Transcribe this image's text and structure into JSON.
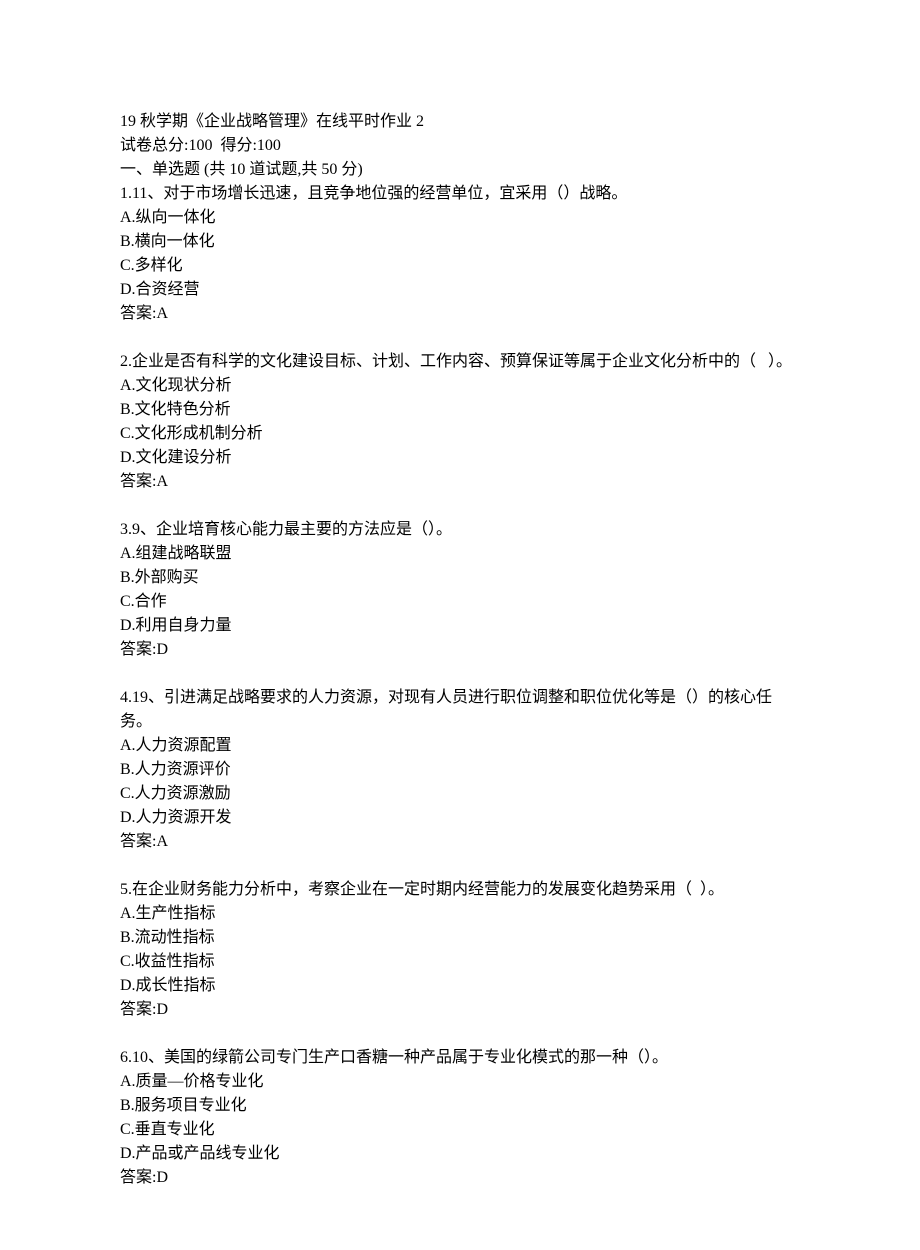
{
  "header": {
    "title": "19 秋学期《企业战略管理》在线平时作业 2",
    "score_line": "试卷总分:100  得分:100",
    "section_line": "一、单选题 (共 10 道试题,共 50 分)"
  },
  "questions": [
    {
      "stem": "1.11、对于市场增长迅速，且竞争地位强的经营单位，宜采用（）战略。",
      "options": [
        "A.纵向一体化",
        "B.横向一体化",
        "C.多样化",
        "D.合资经营"
      ],
      "answer": "答案:A"
    },
    {
      "stem": "2.企业是否有科学的文化建设目标、计划、工作内容、预算保证等属于企业文化分析中的（   ）。",
      "options": [
        "A.文化现状分析",
        "B.文化特色分析",
        "C.文化形成机制分析",
        "D.文化建设分析"
      ],
      "answer": "答案:A"
    },
    {
      "stem": "3.9、企业培育核心能力最主要的方法应是（）。",
      "options": [
        "A.组建战略联盟",
        "B.外部购买",
        "C.合作",
        "D.利用自身力量"
      ],
      "answer": "答案:D"
    },
    {
      "stem": "4.19、引进满足战略要求的人力资源，对现有人员进行职位调整和职位优化等是（）的核心任务。",
      "options": [
        "A.人力资源配置",
        "B.人力资源评价",
        "C.人力资源激励",
        "D.人力资源开发"
      ],
      "answer": "答案:A"
    },
    {
      "stem": "5.在企业财务能力分析中，考察企业在一定时期内经营能力的发展变化趋势采用（  ）。",
      "options": [
        "A.生产性指标",
        "B.流动性指标",
        "C.收益性指标",
        "D.成长性指标"
      ],
      "answer": "答案:D"
    },
    {
      "stem": "6.10、美国的绿箭公司专门生产口香糖一种产品属于专业化模式的那一种（）。",
      "options": [
        "A.质量—价格专业化",
        "B.服务项目专业化",
        "C.垂直专业化",
        "D.产品或产品线专业化"
      ],
      "answer": "答案:D"
    }
  ]
}
